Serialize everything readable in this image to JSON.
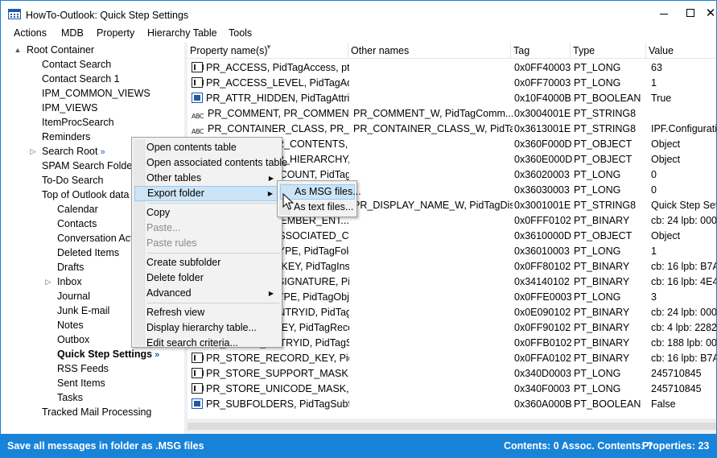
{
  "window": {
    "title": "HowTo-Outlook: Quick Step Settings",
    "close_glyph": "✕"
  },
  "menubar": [
    "Actions",
    "MDB",
    "Property",
    "Hierarchy Table",
    "Tools"
  ],
  "tree": {
    "root": "Root Container",
    "items": [
      {
        "label": "Contact Search"
      },
      {
        "label": "Contact Search 1"
      },
      {
        "label": "IPM_COMMON_VIEWS"
      },
      {
        "label": "IPM_VIEWS"
      },
      {
        "label": "ItemProcSearch"
      },
      {
        "label": "Reminders"
      },
      {
        "label": "Search Root"
      },
      {
        "label": "SPAM Search Folder 2"
      },
      {
        "label": "To-Do Search"
      },
      {
        "label": "Top of Outlook data file"
      },
      {
        "label": "Calendar"
      },
      {
        "label": "Contacts"
      },
      {
        "label": "Conversation Action Settings"
      },
      {
        "label": "Deleted Items"
      },
      {
        "label": "Drafts"
      },
      {
        "label": "Inbox"
      },
      {
        "label": "Journal"
      },
      {
        "label": "Junk E-mail"
      },
      {
        "label": "Notes"
      },
      {
        "label": "Outbox"
      },
      {
        "label": "Quick Step Settings"
      },
      {
        "label": "RSS Feeds"
      },
      {
        "label": "Sent Items"
      },
      {
        "label": "Tasks"
      },
      {
        "label": "Tracked Mail Processing"
      }
    ],
    "chevron": "»"
  },
  "grid": {
    "columns": [
      "Property name(s)",
      "Other names",
      "Tag",
      "Type",
      "Value"
    ],
    "rows": [
      {
        "icon": "num",
        "name": "PR_ACCESS, PidTagAccess, pta...",
        "other": "",
        "tag": "0x0FF40003",
        "type": "PT_LONG",
        "value": "63"
      },
      {
        "icon": "num",
        "name": "PR_ACCESS_LEVEL, PidTagAcce...",
        "other": "",
        "tag": "0x0FF70003",
        "type": "PT_LONG",
        "value": "1"
      },
      {
        "icon": "bool",
        "name": "PR_ATTR_HIDDEN, PidTagAttri...",
        "other": "",
        "tag": "0x10F4000B",
        "type": "PT_BOOLEAN",
        "value": "True"
      },
      {
        "icon": "str",
        "name": "PR_COMMENT, PR_COMMENT...",
        "other": "PR_COMMENT_W, PidTagComm...",
        "tag": "0x3004001E",
        "type": "PT_STRING8",
        "value": ""
      },
      {
        "icon": "str",
        "name": "PR_CONTAINER_CLASS, PR_CO...",
        "other": "PR_CONTAINER_CLASS_W, PidTa...",
        "tag": "0x3613001E",
        "type": "PT_STRING8",
        "value": "IPF.Configuration"
      },
      {
        "icon": "obj",
        "name": "PR_CONTAINER_CONTENTS, Pi...",
        "other": "",
        "tag": "0x360F000D",
        "type": "PT_OBJECT",
        "value": "Object"
      },
      {
        "icon": "obj",
        "name": "PR_CONTAINER_HIERARCHY, P...",
        "other": "",
        "tag": "0x360E000D",
        "type": "PT_OBJECT",
        "value": "Object"
      },
      {
        "icon": "num",
        "name": "PR_CONTENT_COUNT, PidTag...",
        "other": "",
        "tag": "0x36020003",
        "type": "PT_LONG",
        "value": "0"
      },
      {
        "icon": "num",
        "name": "PR_CONTENT_UNREAD, PidTag...",
        "other": "",
        "tag": "0x36030003",
        "type": "PT_LONG",
        "value": "0"
      },
      {
        "icon": "str",
        "name": "PR_DISPLAY_NAME, PR_DISPL...",
        "other": "PR_DISPLAY_NAME_W, PidTagDis...",
        "tag": "0x3001001E",
        "type": "PT_STRING8",
        "value": "Quick Step Settings"
      },
      {
        "icon": "num",
        "name": "PR_EMS_AB_MEMBER_ENT...",
        "other": "",
        "tag": "0x0FFF0102",
        "type": "PT_BINARY",
        "value": "cb: 24 lpb: 000"
      },
      {
        "icon": "obj",
        "name": "PR_FOLDER_ASSOCIATED_CON...",
        "other": "",
        "tag": "0x3610000D",
        "type": "PT_OBJECT",
        "value": "Object"
      },
      {
        "icon": "num",
        "name": "PR_FOLDER_TYPE, PidTagFolde...",
        "other": "",
        "tag": "0x36010003",
        "type": "PT_LONG",
        "value": "1"
      },
      {
        "icon": "num",
        "name": "PR_INSTANCE_KEY, PidTagInst...",
        "other": "",
        "tag": "0x0FF80102",
        "type": "PT_BINARY",
        "value": "cb: 16 lpb: B7A"
      },
      {
        "icon": "num",
        "name": "PR_MAPPING_SIGNATURE, Pid...",
        "other": "",
        "tag": "0x34140102",
        "type": "PT_BINARY",
        "value": "cb: 16 lpb: 4E4"
      },
      {
        "icon": "num",
        "name": "PR_OBJECT_TYPE, PidTagObjec...",
        "other": "",
        "tag": "0x0FFE0003",
        "type": "PT_LONG",
        "value": "3"
      },
      {
        "icon": "num",
        "name": "PR_PARENT_ENTRYID, PidTagP...",
        "other": "",
        "tag": "0x0E090102",
        "type": "PT_BINARY",
        "value": "cb: 24 lpb: 000"
      },
      {
        "icon": "num",
        "name": "PR_RECORD_KEY, PidTagRecor...",
        "other": "",
        "tag": "0x0FF90102",
        "type": "PT_BINARY",
        "value": "cb: 4 lpb: 2282"
      },
      {
        "icon": "num",
        "name": "PR_STORE_ENTRYID, PidTagSt...",
        "other": "",
        "tag": "0x0FFB0102",
        "type": "PT_BINARY",
        "value": "cb: 188 lpb: 00"
      },
      {
        "icon": "num",
        "name": "PR_STORE_RECORD_KEY, PidTa...",
        "other": "",
        "tag": "0x0FFA0102",
        "type": "PT_BINARY",
        "value": "cb: 16 lpb: B7A"
      },
      {
        "icon": "num",
        "name": "PR_STORE_SUPPORT_MASK, Pi...",
        "other": "",
        "tag": "0x340D0003",
        "type": "PT_LONG",
        "value": "245710845"
      },
      {
        "icon": "num",
        "name": "PR_STORE_UNICODE_MASK, Pi...",
        "other": "",
        "tag": "0x340F0003",
        "type": "PT_LONG",
        "value": "245710845"
      },
      {
        "icon": "bool",
        "name": "PR_SUBFOLDERS, PidTagSubfol...",
        "other": "",
        "tag": "0x360A000B",
        "type": "PT_BOOLEAN",
        "value": "False"
      }
    ]
  },
  "context_menu": {
    "items": [
      {
        "label": "Open contents table"
      },
      {
        "label": "Open associated contents table"
      },
      {
        "label": "Other tables",
        "submenu": true
      },
      {
        "label": "Export folder",
        "submenu": true,
        "highlighted": true
      },
      {
        "separator": true
      },
      {
        "label": "Copy"
      },
      {
        "label": "Paste...",
        "disabled": true
      },
      {
        "label": "Paste rules",
        "disabled": true
      },
      {
        "separator": true
      },
      {
        "label": "Create subfolder"
      },
      {
        "label": "Delete folder"
      },
      {
        "label": "Advanced",
        "submenu": true
      },
      {
        "separator": true
      },
      {
        "label": "Refresh view"
      },
      {
        "label": "Display hierarchy table..."
      },
      {
        "label": "Edit search criteria..."
      }
    ]
  },
  "submenu": {
    "items": [
      {
        "label": "As MSG files...",
        "highlighted": true
      },
      {
        "label": "As text files..."
      }
    ]
  },
  "status": {
    "left": "Save all messages in folder as .MSG files",
    "middle": "Contents: 0 Assoc. Contents: ?",
    "right": "Properties: 23"
  },
  "colors": {
    "accent": "#1883d7",
    "highlight": "#cce4f7"
  }
}
